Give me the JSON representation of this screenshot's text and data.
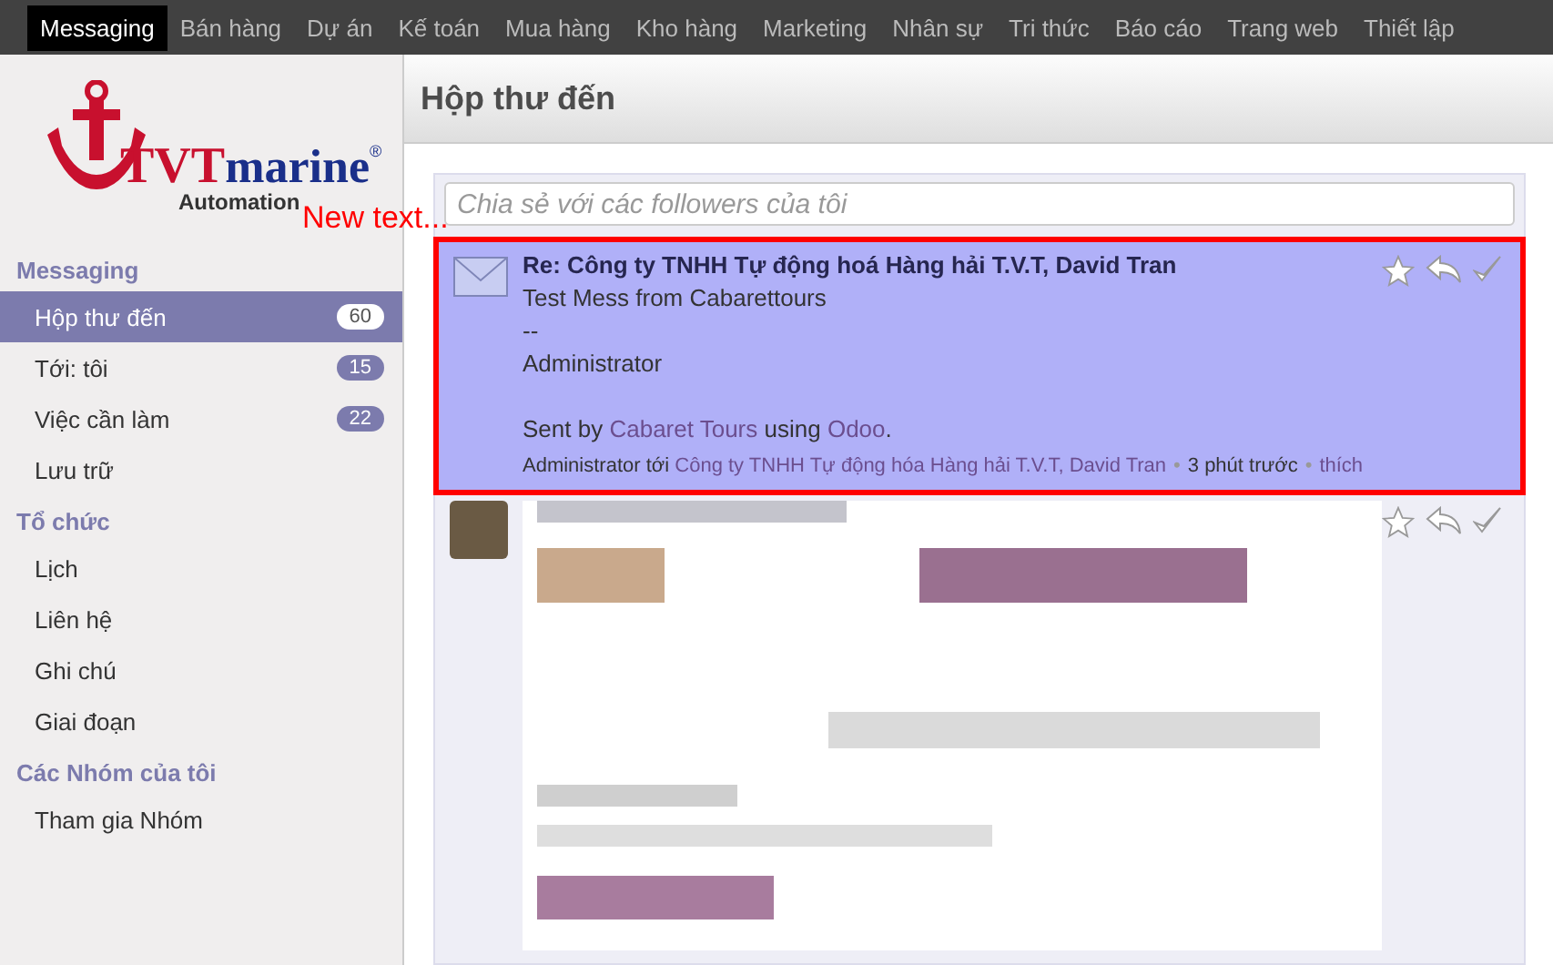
{
  "top_menu": [
    {
      "label": "Messaging",
      "selected": true
    },
    {
      "label": "Bán hàng",
      "selected": false
    },
    {
      "label": "Dự án",
      "selected": false
    },
    {
      "label": "Kế toán",
      "selected": false
    },
    {
      "label": "Mua hàng",
      "selected": false
    },
    {
      "label": "Kho hàng",
      "selected": false
    },
    {
      "label": "Marketing",
      "selected": false
    },
    {
      "label": "Nhân sự",
      "selected": false
    },
    {
      "label": "Tri thức",
      "selected": false
    },
    {
      "label": "Báo cáo",
      "selected": false
    },
    {
      "label": "Trang web",
      "selected": false
    },
    {
      "label": "Thiết lập",
      "selected": false
    }
  ],
  "logo": {
    "brand_a": "TVT",
    "brand_b": "marine",
    "mark": "®",
    "tagline": "Automation",
    "annotation": "New text..."
  },
  "sidebar": {
    "sections": [
      {
        "title": "Messaging",
        "items": [
          {
            "label": "Hộp thư đến",
            "count": "60",
            "selected": true
          },
          {
            "label": "Tới: tôi",
            "count": "15",
            "selected": false
          },
          {
            "label": "Việc cần làm",
            "count": "22",
            "selected": false
          },
          {
            "label": "Lưu trữ",
            "selected": false
          }
        ]
      },
      {
        "title": "Tổ chức",
        "items": [
          {
            "label": "Lịch",
            "selected": false
          },
          {
            "label": "Liên hệ",
            "selected": false
          },
          {
            "label": "Ghi chú",
            "selected": false
          },
          {
            "label": "Giai đoạn",
            "selected": false
          }
        ]
      },
      {
        "title": "Các Nhóm của tôi",
        "items": [
          {
            "label": "Tham gia Nhóm",
            "selected": false
          }
        ]
      }
    ]
  },
  "page_title": "Hộp thư đến",
  "composer": {
    "placeholder": "Chia sẻ với các followers của tôi"
  },
  "messages": [
    {
      "kind": "mail",
      "highlighted": true,
      "subject": "Re: Công ty TNHH Tự động hoá Hàng hải T.V.T, David Tran",
      "body": [
        "Test Mess from Cabarettours",
        "--",
        "Administrator"
      ],
      "sent_by": "Sent by",
      "sender_link": "Cabaret Tours",
      "using": "using",
      "app_link": "Odoo",
      "period": ".",
      "author": "Administrator tới",
      "recipient": "Công ty TNHH Tự động hóa Hàng hải T.V.T, David Tran",
      "separator": "•",
      "time": "3 phút trước",
      "like": "thích"
    },
    {
      "kind": "blurred"
    }
  ]
}
